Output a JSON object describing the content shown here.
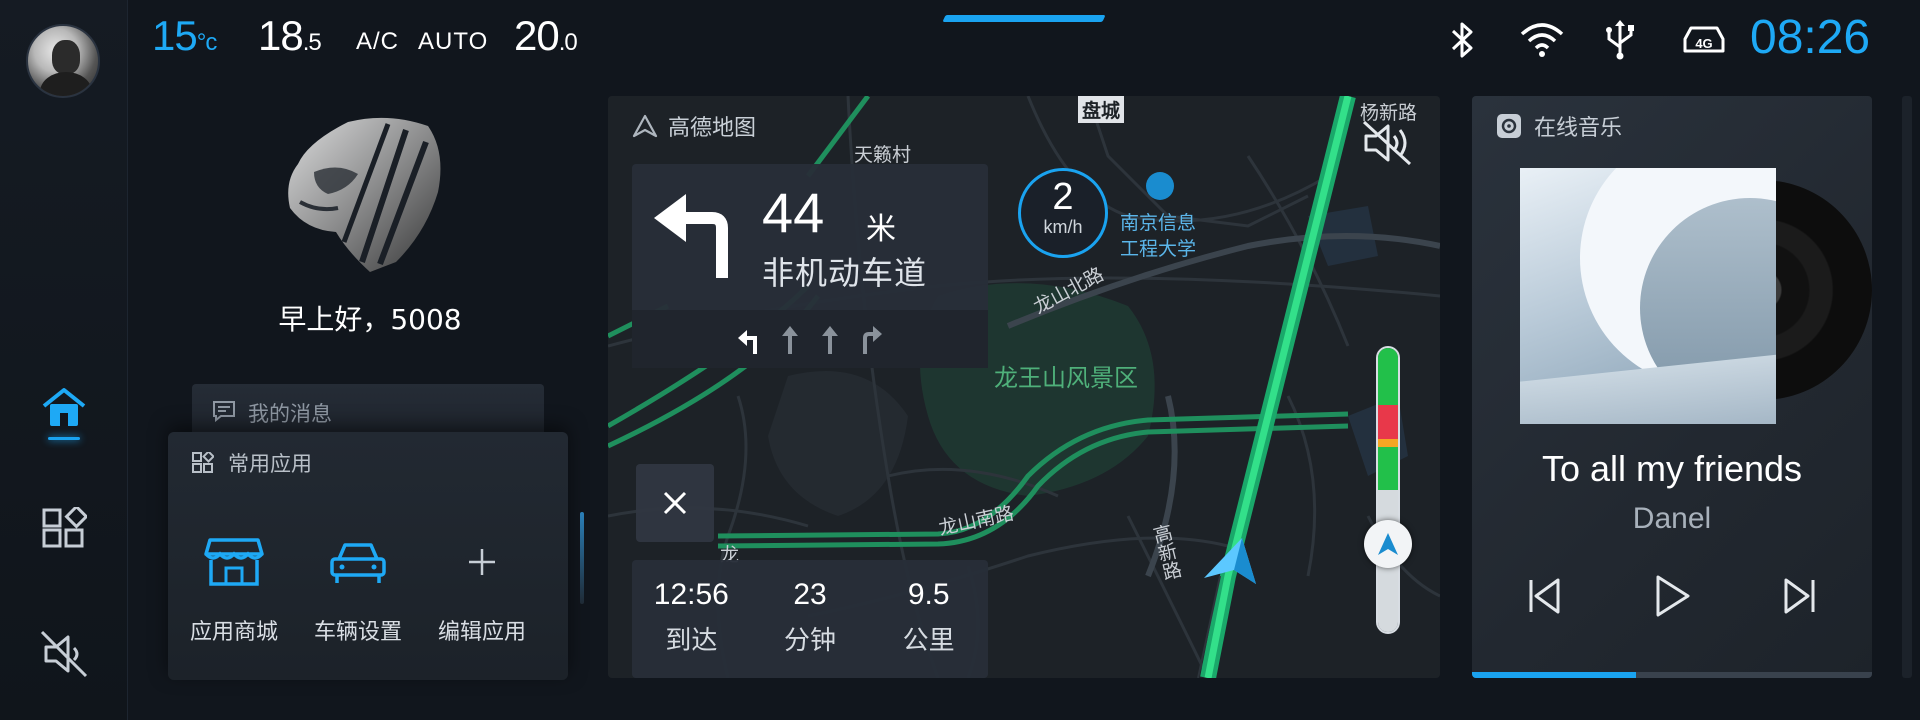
{
  "status_bar": {
    "outside_temp": "15",
    "outside_temp_unit": "°c",
    "left_temp_int": "18",
    "left_temp_dec": ".5",
    "ac_label": "A/C",
    "auto_label": "AUTO",
    "right_temp_int": "20",
    "right_temp_dec": ".0",
    "network_label": "4G",
    "clock": "08:26",
    "icons": [
      "bluetooth-icon",
      "wifi-icon",
      "usb-icon",
      "4g-icon"
    ]
  },
  "sidebar": {
    "items": [
      {
        "name": "home",
        "icon": "home-icon",
        "active": true
      },
      {
        "name": "apps",
        "icon": "apps-grid-icon",
        "active": false
      },
      {
        "name": "mute",
        "icon": "speaker-muted-icon",
        "active": false
      }
    ]
  },
  "greeting": "早上好，5008",
  "messages": {
    "label": "我的消息"
  },
  "common_apps": {
    "title": "常用应用",
    "items": [
      {
        "label": "应用商城",
        "icon": "store-icon"
      },
      {
        "label": "车辆设置",
        "icon": "car-icon"
      },
      {
        "label": "编辑应用",
        "icon": "plus-icon"
      }
    ]
  },
  "navigation": {
    "brand": "高德地图",
    "turn": {
      "distance": "44",
      "unit": "米",
      "road": "非机动车道",
      "direction": "turn-left"
    },
    "lanes": [
      "turn-left",
      "straight",
      "straight",
      "turn-right"
    ],
    "speed": {
      "value": "2",
      "unit": "km/h"
    },
    "eta": [
      {
        "value": "12:56",
        "label": "到达"
      },
      {
        "value": "23",
        "label": "分钟"
      },
      {
        "value": "9.5",
        "label": "公里"
      }
    ],
    "map_labels": {
      "l1": "天籁村",
      "l2": "盘城",
      "l3": "杨新路",
      "l4": "南京信息",
      "l5": "工程大学",
      "l6": "龙山北路",
      "l7": "龙王山风景区",
      "l8": "龙山南路",
      "l9": "龙",
      "l10": "高新路"
    },
    "traffic_position": 0.53
  },
  "music": {
    "source": "在线音乐",
    "title": "To all my friends",
    "artist": "Danel",
    "progress": 0.41
  },
  "colors": {
    "accent": "#1aa3f0",
    "route": "#2fdc78",
    "congestion_red": "#e8384a",
    "congestion_orange": "#f5a623",
    "clear_green": "#22c04a"
  }
}
